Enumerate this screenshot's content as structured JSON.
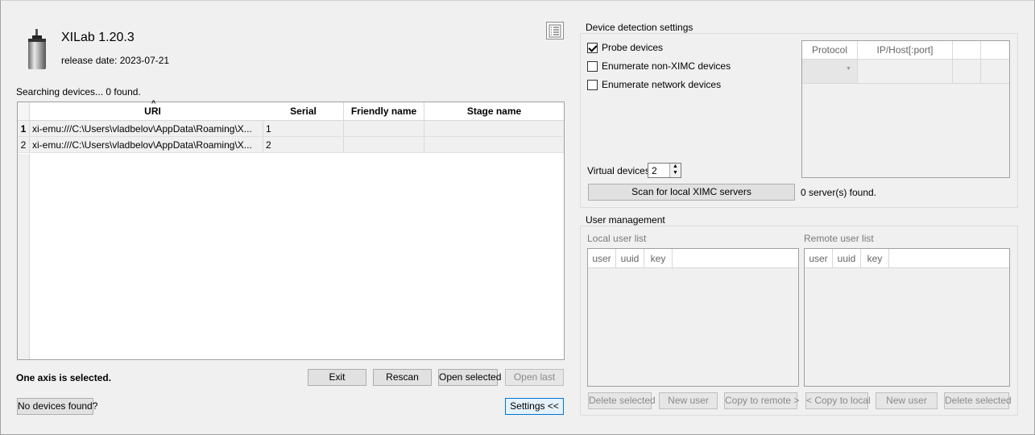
{
  "app": {
    "title": "XILab 1.20.3",
    "release_date": "release date: 2023-07-21",
    "logo_icon": "motor-icon",
    "log_icon": "log-list-icon"
  },
  "devices": {
    "status": "Searching devices... 0 found.",
    "columns": [
      "URI",
      "Serial",
      "Friendly name",
      "Stage name"
    ],
    "rows": [
      {
        "num": "1",
        "uri": "xi-emu:///C:\\Users\\vladbelov\\AppData\\Roaming\\X...",
        "serial": "1",
        "friendly": "",
        "stage": ""
      },
      {
        "num": "2",
        "uri": "xi-emu:///C:\\Users\\vladbelov\\AppData\\Roaming\\X...",
        "serial": "2",
        "friendly": "",
        "stage": ""
      }
    ],
    "selection_status": "One axis is selected."
  },
  "buttons": {
    "exit": "Exit",
    "rescan": "Rescan",
    "open_selected": "Open selected",
    "open_last": "Open last",
    "no_devices": "No devices found?",
    "settings": "Settings <<"
  },
  "detection": {
    "title": "Device detection settings",
    "probe_devices": "Probe devices",
    "probe_checked": true,
    "enumerate_non_ximc": "Enumerate non-XIMC devices",
    "enumerate_network": "Enumerate network devices",
    "protocol_col": "Protocol",
    "iphost_col": "IP/Host[:port]",
    "virtual_devices_label": "Virtual devices",
    "virtual_devices_value": "2",
    "scan_button": "Scan for local XIMC servers",
    "servers_found": "0 server(s) found."
  },
  "users": {
    "title": "User management",
    "local_label": "Local user list",
    "remote_label": "Remote user list",
    "columns": [
      "user",
      "uuid",
      "key"
    ],
    "delete_selected": "Delete selected",
    "new_user": "New user",
    "copy_to_remote": "Copy to remote >",
    "copy_to_local": "< Copy to local"
  }
}
